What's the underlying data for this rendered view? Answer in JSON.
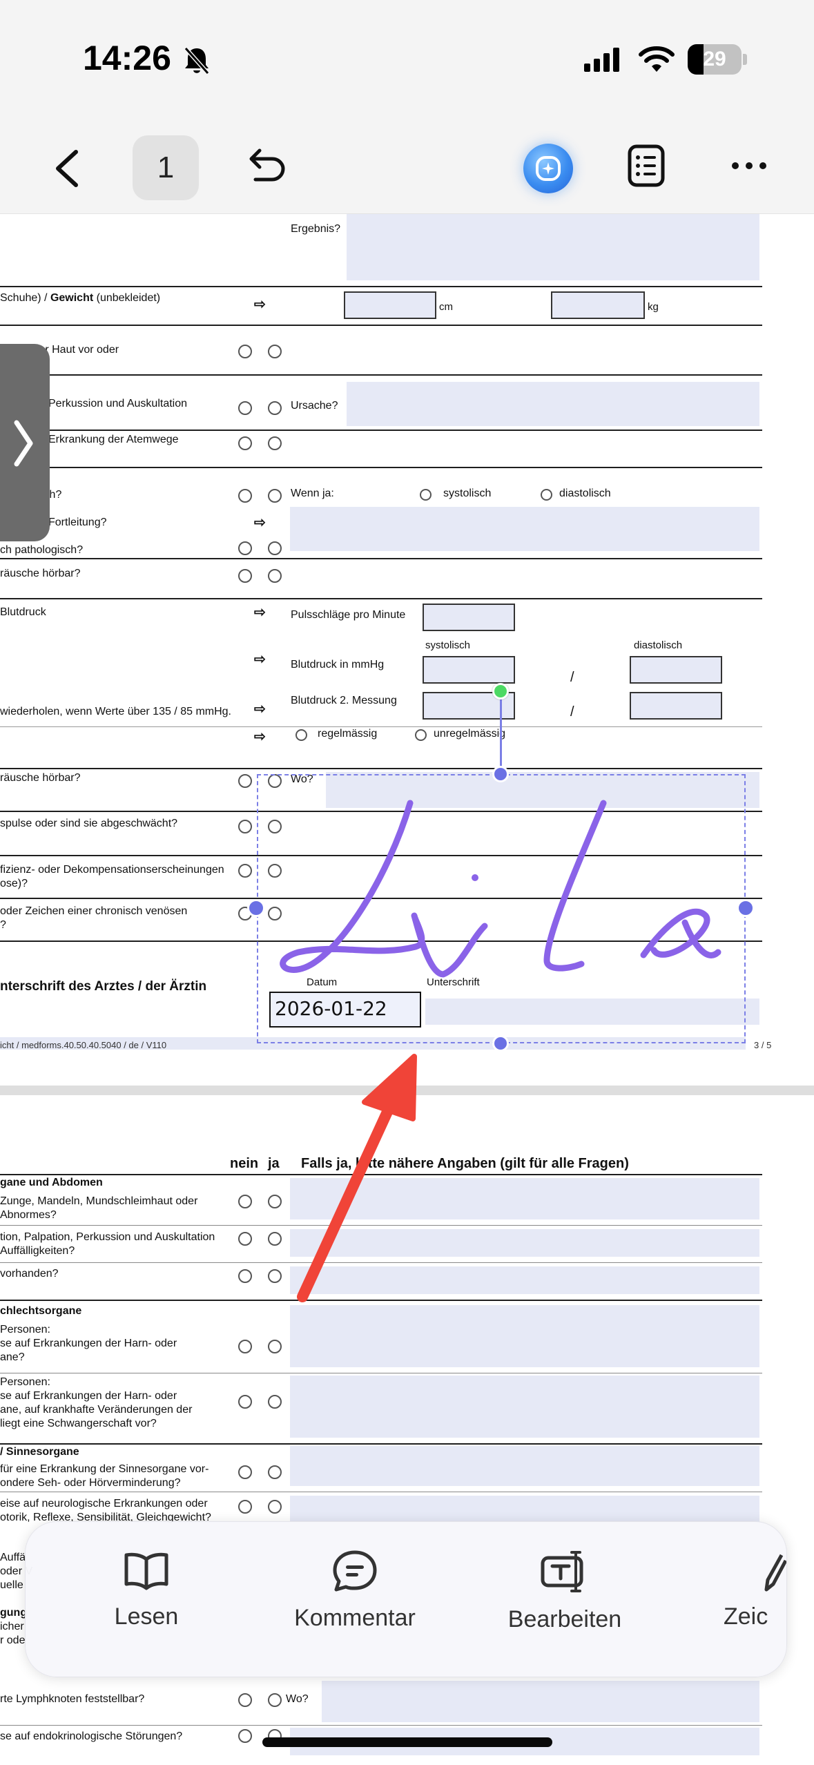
{
  "status_bar": {
    "time": "14:26",
    "battery": "29"
  },
  "toolbar": {
    "page_number": "1"
  },
  "icons": {
    "back": "chevron-left-icon",
    "undo": "undo-icon",
    "ai": "ai-assistant-icon",
    "outline": "list-icon",
    "more": "more-icon",
    "bell": "bell-slash-icon",
    "side_tab": "chevron-right-icon"
  },
  "page1": {
    "ergebnis": "Ergebnis?",
    "row_size_a": "Schuhe) / ",
    "row_size_b": "Gewicht",
    "row_size_c": " (unbekleidet)",
    "unit_cm": "cm",
    "unit_kg": "kg",
    "row_haut": "ter Haut vor oder",
    "row_perkussion": "Perkussion und Auskultation",
    "ursache": "Ursache?",
    "row_atemwege": "Erkrankung der Atemwege",
    "row_isch": "isch?",
    "wenn_ja": "Wenn ja:",
    "systolisch_opt": "systolisch",
    "diastolisch_opt": "diastolisch",
    "row_fortleitung": "Fortleitung?",
    "row_pathologisch": "ch pathologisch?",
    "row_gerausche1": "räusche hörbar?",
    "row_blutdruck": "Blutdruck",
    "pulsschlaege": "Pulsschläge pro Minute",
    "systolisch_head": "systolisch",
    "diastolisch_head": "diastolisch",
    "blutdruck_mmhg": "Blutdruck in mmHg",
    "blutdruck_2": "Blutdruck 2. Messung",
    "row_wiederholen": "wiederholen, wenn Werte über 135 / 85 mmHg.",
    "regelmaessig": "regelmässig",
    "unregelmaessig": "unregelmässig",
    "slash": "/",
    "row_gerausche2": "räusche hörbar?",
    "wo": "Wo?",
    "row_pulse": "spulse oder sind sie abgeschwächt?",
    "row_insuff_1": "fizienz- oder Dekompensationserscheinungen",
    "row_insuff_2": "ose)?",
    "row_venoes_1": "oder Zeichen einer chronisch venösen",
    "row_venoes_2": "?",
    "unterschrift_arzt": "nterschrift des Arztes / der Ärztin",
    "datum_label": "Datum",
    "unterschrift_label": "Unterschrift",
    "date_value": "2026-01-22",
    "signature_text": "Lila",
    "footer_left": "icht / medforms.40.50.40.5040 / de / V110",
    "footer_right": "3 / 5"
  },
  "page2": {
    "col_nein": "nein",
    "col_ja": "ja",
    "col_falls": "Falls ja, bitte nähere Angaben (gilt für alle Fragen)",
    "sec_abdomen": "gane und Abdomen",
    "r1_a": "Zunge, Mandeln, Mundschleimhaut oder",
    "r1_b": "Abnormes?",
    "r2_a": "tion, Palpation, Perkussion und Auskultation",
    "r2_b": "Auffälligkeiten?",
    "r3": "vorhanden?",
    "sec_geschlecht": "chlechtsorgane",
    "r4_a": "Personen:",
    "r4_b": "se auf Erkrankungen der Harn- oder",
    "r4_c": "ane?",
    "r5_a": "Personen:",
    "r5_b": "se auf Erkrankungen der Harn- oder",
    "r5_c": "ane, auf krankhafte Veränderungen der",
    "r5_d": "liegt eine Schwangerschaft vor?",
    "sec_sinne": "/ Sinnesorgane",
    "r6_a": "für eine Erkrankung der Sinnesorgane vor-",
    "r6_b": "ondere Seh- oder Hörverminderung?",
    "r7_a": "eise auf neurologische Erkrankungen oder",
    "r7_b": "otorik, Reflexe, Sensibilität, Gleichgewicht?",
    "r8_a": "Auffä",
    "r8_b": "oder V",
    "r8_c": "uelle",
    "r9_a": "gung",
    "r9_b": "icher",
    "r9_c": "r ode",
    "r10": "rte Lymphknoten feststellbar?",
    "wo": "Wo?",
    "r11": "se auf endokrinologische Störungen?"
  },
  "bottom_bar": {
    "items": [
      {
        "label": "Lesen",
        "icon": "book-icon"
      },
      {
        "label": "Kommentar",
        "icon": "comment-icon"
      },
      {
        "label": "Bearbeiten",
        "icon": "text-edit-icon"
      },
      {
        "label": "Zeic",
        "icon": "pen-icon"
      }
    ]
  },
  "colors": {
    "field": "#e6e9f6",
    "selection": "#7b7fe6",
    "signature": "#8a63e8",
    "annotation_arrow": "#f04438"
  }
}
